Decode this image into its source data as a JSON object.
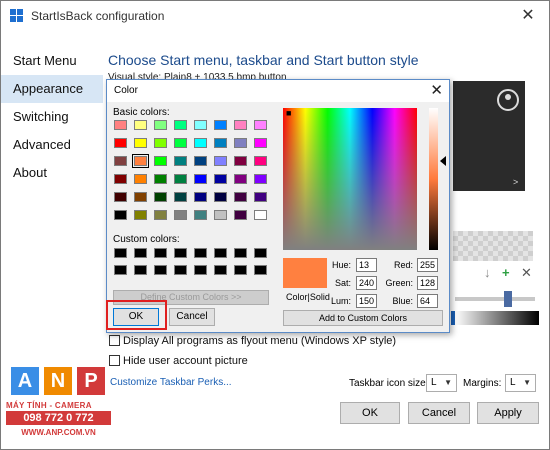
{
  "window": {
    "title": "StartIsBack configuration",
    "close_glyph": "✕"
  },
  "nav": {
    "items": [
      {
        "label": "Start Menu"
      },
      {
        "label": "Appearance"
      },
      {
        "label": "Switching"
      },
      {
        "label": "Advanced"
      },
      {
        "label": "About"
      }
    ],
    "active_index": 1
  },
  "content": {
    "header": "Choose Start menu, taskbar and Start button style",
    "visual_style": "Visual style:  Plain8 + 1033.5 bmp button"
  },
  "options": {
    "display_flyout": "Display All programs as flyout menu (Windows XP style)",
    "hide_picture": "Hide user account picture"
  },
  "footer": {
    "customize_link": "Customize Taskbar Perks...",
    "taskbar_icon_size_label": "Taskbar icon size:",
    "taskbar_icon_size_value": "L",
    "margins_label": "Margins:",
    "margins_value": "L",
    "ok": "OK",
    "cancel": "Cancel",
    "apply": "Apply"
  },
  "watermark": {
    "letters": [
      "A",
      "N",
      "P"
    ],
    "subtitle": "MÁY TÍNH - CAMERA",
    "phone": "098 772 0 772",
    "website": "WWW.ANP.COM.VN"
  },
  "color_dialog": {
    "title": "Color",
    "close_glyph": "✕",
    "basic_colors_label": "Basic colors:",
    "custom_colors_label": "Custom colors:",
    "define_custom_button": "Define Custom Colors >>",
    "ok": "OK",
    "cancel": "Cancel",
    "add_custom_button": "Add to Custom Colors",
    "color_solid_label": "Color|Solid",
    "fields": {
      "hue_label": "Hue:",
      "hue": "13",
      "sat_label": "Sat:",
      "sat": "240",
      "lum_label": "Lum:",
      "lum": "150",
      "red_label": "Red:",
      "red": "255",
      "green_label": "Green:",
      "green": "128",
      "blue_label": "Blue:",
      "blue": "64"
    },
    "selected_color": "#ff8040",
    "basic_colors": [
      [
        "#ff8080",
        "#ffff80",
        "#80ff80",
        "#00ff80",
        "#80ffff",
        "#0080ff",
        "#ff80c0",
        "#ff80ff"
      ],
      [
        "#ff0000",
        "#ffff00",
        "#80ff00",
        "#00ff40",
        "#00ffff",
        "#0080c0",
        "#8080c0",
        "#ff00ff"
      ],
      [
        "#804040",
        "#ff8040",
        "#00ff00",
        "#008080",
        "#004080",
        "#8080ff",
        "#800040",
        "#ff0080"
      ],
      [
        "#800000",
        "#ff8000",
        "#008000",
        "#008040",
        "#0000ff",
        "#0000a0",
        "#800080",
        "#8000ff"
      ],
      [
        "#400000",
        "#804000",
        "#004000",
        "#004040",
        "#000080",
        "#000040",
        "#400040",
        "#400080"
      ],
      [
        "#000000",
        "#808000",
        "#808040",
        "#808080",
        "#408080",
        "#c0c0c0",
        "#400040",
        "#ffffff"
      ]
    ],
    "selected_basic_index": [
      2,
      1
    ],
    "custom_colors_count": 16,
    "custom_color": "#000000"
  }
}
